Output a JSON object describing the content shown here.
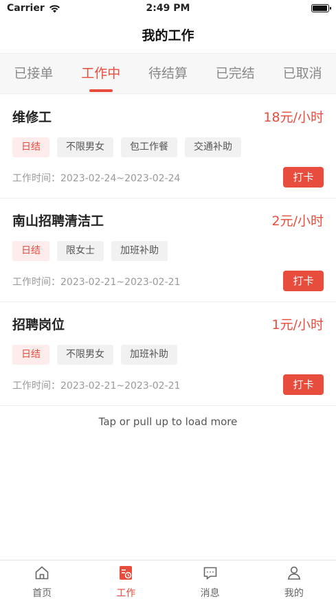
{
  "status_bar": {
    "carrier": "Carrier",
    "time": "2:49 PM",
    "battery_level": 1.0
  },
  "page_title": "我的工作",
  "tabs": [
    {
      "label": "已接单",
      "active": false
    },
    {
      "label": "工作中",
      "active": true
    },
    {
      "label": "待结算",
      "active": false
    },
    {
      "label": "已完结",
      "active": false
    },
    {
      "label": "已取消",
      "active": false
    }
  ],
  "work_time_prefix": "工作时间：",
  "clock_label": "打卡",
  "jobs": [
    {
      "title": "维修工",
      "salary": "18元/小时",
      "tags": [
        "日结",
        "不限男女",
        "包工作餐",
        "交通补助"
      ],
      "work_time": "2023-02-24~2023-02-24"
    },
    {
      "title": "南山招聘清洁工",
      "salary": "2元/小时",
      "tags": [
        "日结",
        "限女士",
        "加班补助"
      ],
      "work_time": "2023-02-21~2023-02-21"
    },
    {
      "title": "招聘岗位",
      "salary": "1元/小时",
      "tags": [
        "日结",
        "不限男女",
        "加班补助"
      ],
      "work_time": "2023-02-21~2023-02-21"
    }
  ],
  "load_more": "Tap or pull up to load more",
  "tab_bar": [
    {
      "label": "首页",
      "icon": "home-icon",
      "active": false
    },
    {
      "label": "工作",
      "icon": "work-icon",
      "active": true
    },
    {
      "label": "消息",
      "icon": "message-icon",
      "active": false
    },
    {
      "label": "我的",
      "icon": "profile-icon",
      "active": false
    }
  ],
  "colors": {
    "accent": "#e84c3d",
    "tag_daily_bg": "#fdeceb",
    "tag_bg": "#f1f1f1"
  }
}
